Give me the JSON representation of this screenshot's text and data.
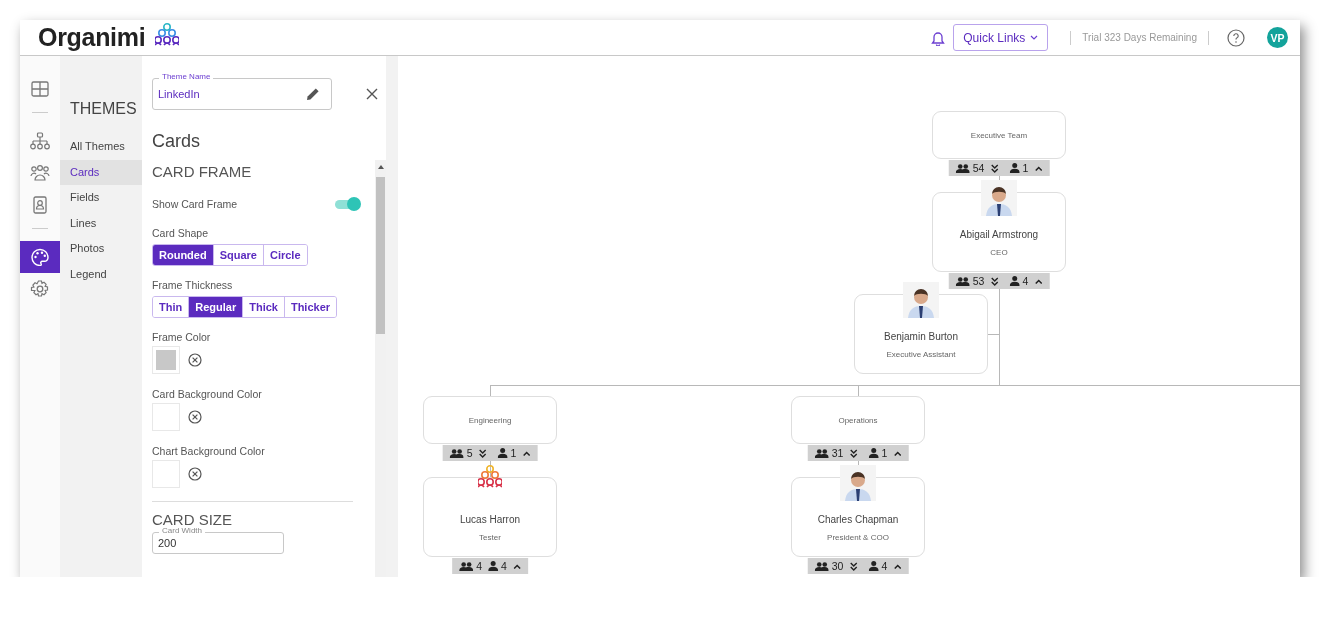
{
  "header": {
    "logo": "Organimi",
    "quick_links": "Quick Links",
    "trial": "Trial 323 Days Remaining",
    "avatar": "VP"
  },
  "rail": {
    "groups": [
      {
        "items": [
          {
            "kind": "grid",
            "selected": false
          }
        ]
      },
      {
        "items": [
          {
            "kind": "org",
            "selected": false
          },
          {
            "kind": "people",
            "selected": false
          },
          {
            "kind": "contact",
            "selected": false
          }
        ]
      },
      {
        "items": [
          {
            "kind": "palette",
            "selected": true
          },
          {
            "kind": "gear",
            "selected": false
          }
        ]
      }
    ]
  },
  "themes_menu": {
    "title": "THEMES",
    "items": [
      {
        "label": "All Themes",
        "selected": false
      },
      {
        "label": "Cards",
        "selected": true
      },
      {
        "label": "Fields",
        "selected": false
      },
      {
        "label": "Lines",
        "selected": false
      },
      {
        "label": "Photos",
        "selected": false
      },
      {
        "label": "Legend",
        "selected": false
      }
    ]
  },
  "panel": {
    "theme_name": {
      "label": "Theme Name",
      "value": "LinkedIn"
    },
    "heading": "Cards",
    "card_frame": {
      "heading": "CARD FRAME",
      "toggle": {
        "label": "Show Card Frame",
        "on": true
      },
      "option_groups": [
        {
          "label": "Card Shape",
          "options": [
            {
              "label": "Rounded",
              "selected": true
            },
            {
              "label": "Square",
              "selected": false
            },
            {
              "label": "Circle",
              "selected": false
            }
          ]
        },
        {
          "label": "Frame Thickness",
          "options": [
            {
              "label": "Thin",
              "selected": false
            },
            {
              "label": "Regular",
              "selected": true
            },
            {
              "label": "Thick",
              "selected": false
            },
            {
              "label": "Thicker",
              "selected": false
            }
          ]
        }
      ],
      "colors": [
        {
          "label": "Frame Color",
          "color": "#c8c8c8"
        },
        {
          "label": "Card Background Color",
          "color": "#ffffff"
        },
        {
          "label": "Chart Background Color",
          "color": "#ffffff"
        }
      ]
    },
    "card_size": {
      "heading": "CARD SIZE",
      "field": {
        "label": "Card Width",
        "value": "200"
      }
    }
  },
  "chart": {
    "nodes": [
      {
        "kind": "team",
        "title": "Executive Team",
        "team_count": "54",
        "direct_count": "1",
        "expand_all": true,
        "children": [
          {
            "kind": "person",
            "title": "Abigail Armstrong",
            "subtitle": "CEO",
            "photo": {
              "kind": "picture"
            },
            "team_count": "53",
            "direct_count": "4",
            "expand_all": true,
            "children": [
              {
                "kind": "person",
                "assistant": true,
                "title": "Benjamin Burton",
                "subtitle": "Executive Assistant",
                "photo": {
                  "kind": "picture"
                }
              },
              {
                "kind": "team",
                "title": "Engineering",
                "team_count": "5",
                "direct_count": "1",
                "expand_all": true,
                "children": [
                  {
                    "kind": "person",
                    "title": "Lucas Harron",
                    "subtitle": "Tester",
                    "photo": {
                      "kind": "logo"
                    },
                    "team_count": "4",
                    "direct_count": "4",
                    "expand_all": false
                  }
                ]
              },
              {
                "kind": "team",
                "title": "Operations",
                "team_count": "31",
                "direct_count": "1",
                "expand_all": true,
                "children": [
                  {
                    "kind": "person",
                    "title": "Charles Chapman",
                    "subtitle": "President & COO",
                    "photo": {
                      "kind": "picture"
                    },
                    "team_count": "30",
                    "direct_count": "4",
                    "expand_all": true
                  }
                ]
              }
            ]
          }
        ]
      }
    ]
  }
}
